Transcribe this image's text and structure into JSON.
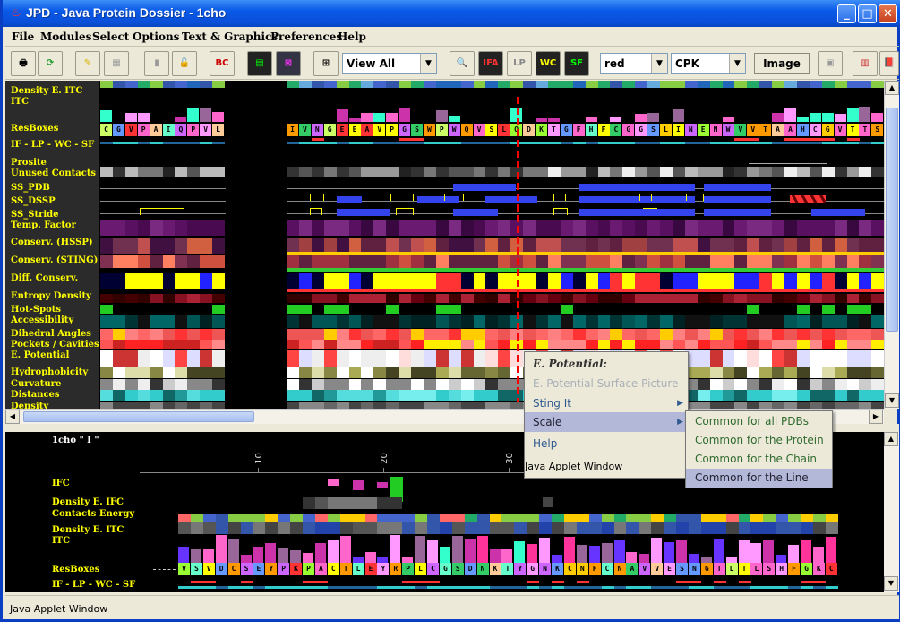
{
  "window": {
    "title": "JPD - Java Protein Dossier - 1cho"
  },
  "menubar": [
    "File",
    "Modules",
    "Select",
    "Options",
    "Text & Graphics",
    "Preferences",
    "Help"
  ],
  "toolbar": {
    "glyph_bc": "BC",
    "glyph_ifa": "IFA",
    "glyph_lp": "LP",
    "glyph_wc": "WC",
    "glyph_sf": "SF",
    "view_combo": "View All",
    "color_combo": "red",
    "render_combo": "CPK",
    "image_button": "Image"
  },
  "top_tracks": [
    "Density E. ITC",
    "ITC",
    "ResBoxes",
    "IF - LP - WC - SF",
    "Prosite",
    "Unused Contacts",
    "SS_PDB",
    "SS_DSSP",
    "SS_Stride",
    "Temp. Factor",
    "Conserv. (HSSP)",
    "Conserv. (STING)",
    "Diff. Conserv.",
    "Entropy Density",
    "Hot-Spots",
    "Accessibility",
    "Dihedral Angles",
    "Pockets / Cavities",
    "E. Potential",
    "Hydrophobicity",
    "Curvature",
    "Distances",
    "Density"
  ],
  "top_sequence_left": [
    "C",
    "G",
    "V",
    "P",
    "A",
    "I",
    "Q",
    "P",
    "V",
    "L"
  ],
  "top_sequence_right": [
    "I",
    "V",
    "N",
    "G",
    "E",
    "E",
    "A",
    "V",
    "P",
    "G",
    "S",
    "W",
    "P",
    "W",
    "Q",
    "V",
    "S",
    "L",
    "Q",
    "D",
    "K",
    "T",
    "G",
    "F",
    "H",
    "F",
    "C",
    "G",
    "G",
    "S",
    "L",
    "I",
    "N",
    "E",
    "N",
    "W",
    "V",
    "V",
    "T",
    "A",
    "A",
    "H",
    "C",
    "G",
    "V",
    "T",
    "T",
    "S"
  ],
  "bottom_pane": {
    "chain_label": "1cho \" I \"",
    "ruler": [
      "10",
      "20",
      "30"
    ],
    "tracks": [
      "IFC",
      "Density E. IFC",
      "Contacts Energy",
      "Density E. ITC",
      "ITC",
      "ResBoxes",
      "IF - LP - WC - SF"
    ],
    "sequence": [
      "V",
      "S",
      "V",
      "D",
      "C",
      "S",
      "E",
      "Y",
      "P",
      "K",
      "P",
      "A",
      "C",
      "T",
      "L",
      "E",
      "Y",
      "R",
      "P",
      "L",
      "C",
      "G",
      "S",
      "D",
      "N",
      "K",
      "T",
      "Y",
      "G",
      "N",
      "K",
      "C",
      "N",
      "F",
      "C",
      "N",
      "A",
      "V",
      "V",
      "E",
      "S",
      "N",
      "G",
      "T",
      "L",
      "T",
      "L",
      "S",
      "H",
      "F",
      "G",
      "K",
      "C"
    ]
  },
  "context_menu": {
    "header": "E. Potential:",
    "items": [
      {
        "label": "E. Potential Surface Picture",
        "disabled": true
      },
      {
        "label": "Sting It",
        "submenu": true
      },
      {
        "label": "Scale",
        "submenu": true,
        "selected": true
      },
      {
        "label": "Help"
      }
    ],
    "footer": "Java Applet Window"
  },
  "submenu": {
    "items": [
      {
        "label": "Common for all PDBs"
      },
      {
        "label": "Common for the Protein"
      },
      {
        "label": "Common for the Chain"
      },
      {
        "label": "Common for the Line",
        "selected": true
      }
    ]
  },
  "status": "Java Applet Window",
  "colors": {
    "titlebar": "#0a59e8",
    "label": "#ffff00",
    "track_bg": "#000000",
    "menu_select": "#b4b8d8"
  }
}
